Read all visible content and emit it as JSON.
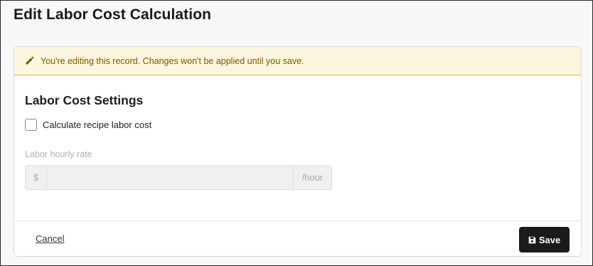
{
  "page": {
    "title": "Edit Labor Cost Calculation"
  },
  "notice": {
    "icon": "pencil-icon",
    "text": "You're editing this record. Changes won't be applied until you save.",
    "color": "#7a5a00",
    "background": "#fcf6df"
  },
  "settings": {
    "section_title": "Labor Cost Settings",
    "calculate_checkbox": {
      "label": "Calculate recipe labor cost",
      "checked": false
    },
    "hourly_rate": {
      "label": "Labor hourly rate",
      "prefix": "$",
      "suffix": "/hour",
      "value": "",
      "disabled": true
    }
  },
  "footer": {
    "cancel_label": "Cancel",
    "save_label": "Save",
    "save_icon": "floppy-disk-icon"
  }
}
